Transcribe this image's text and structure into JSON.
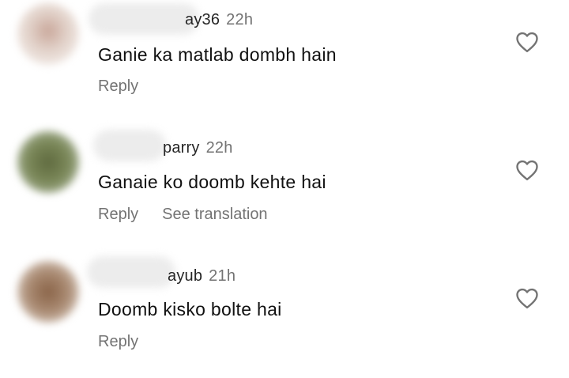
{
  "comments": [
    {
      "username_visible": "ay36",
      "timestamp": "22h",
      "text": "Ganie  ka matlab dombh hain",
      "actions": {
        "reply": "Reply"
      },
      "like_icon": "heart-outline-icon",
      "avatar_color": "#e5d8d1"
    },
    {
      "username_visible": "parry",
      "timestamp": "22h",
      "text": "Ganaie ko  doomb kehte hai",
      "actions": {
        "reply": "Reply",
        "see_translation": "See translation"
      },
      "like_icon": "heart-outline-icon",
      "avatar_color": "#6e7a4e"
    },
    {
      "username_visible": "ayub",
      "timestamp": "21h",
      "text": "Doomb kisko bolte hai",
      "actions": {
        "reply": "Reply"
      },
      "like_icon": "heart-outline-icon",
      "avatar_color": "#9c7a63"
    }
  ],
  "colors": {
    "text": "#111111",
    "secondary": "#737373",
    "background": "#ffffff"
  }
}
